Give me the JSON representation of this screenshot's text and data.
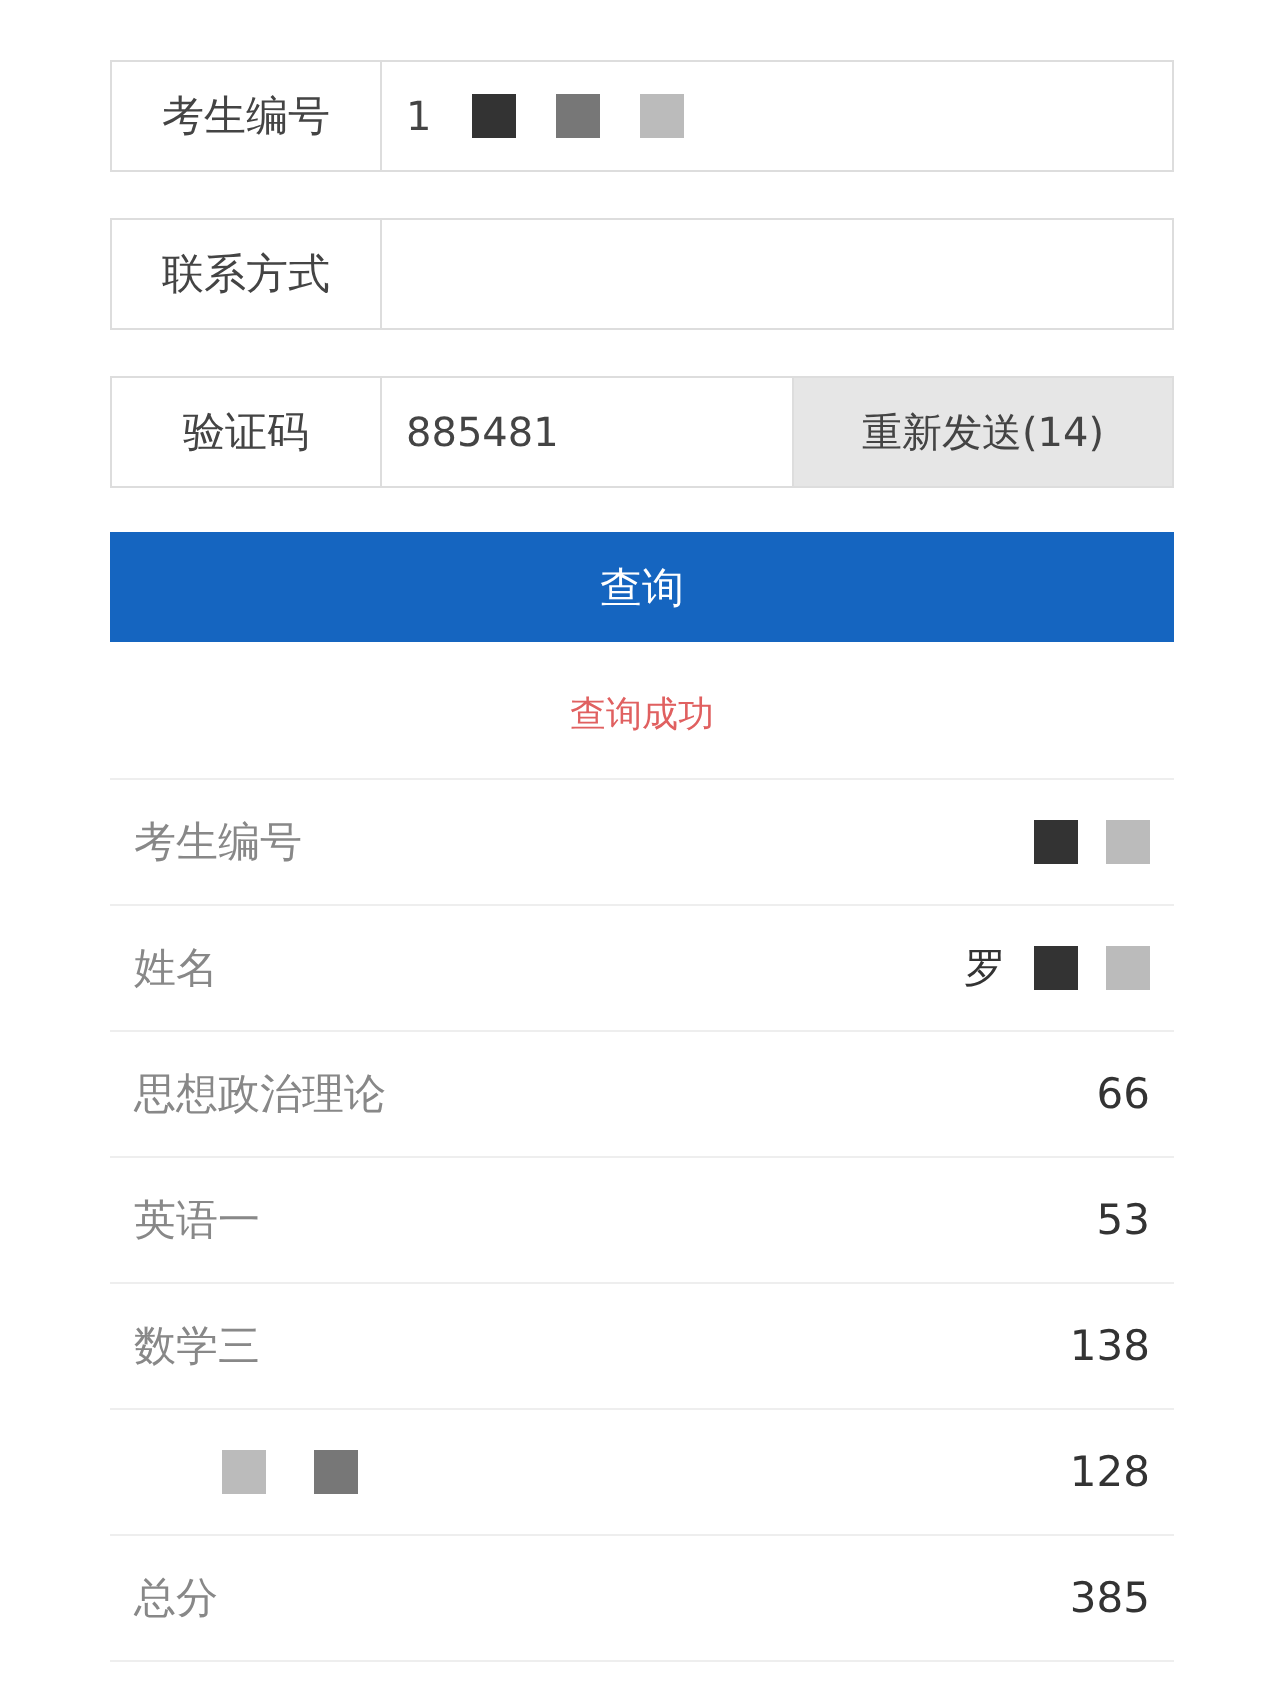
{
  "form": {
    "fields": [
      {
        "label": "考生编号",
        "value": "1",
        "redacted": true
      },
      {
        "label": "联系方式",
        "redacted": false
      },
      {
        "label": "验证码",
        "value": "885481",
        "redacted": false,
        "action": "重新发送(14)"
      }
    ],
    "submit": "查询",
    "status": "查询成功"
  },
  "results": [
    {
      "label": "考生编号",
      "redacted": true
    },
    {
      "label": "姓名",
      "value": "罗",
      "redacted": true
    },
    {
      "label": "思想政治理论",
      "value": "66",
      "redacted": false
    },
    {
      "label": "英语一",
      "value": "53",
      "redacted": false
    },
    {
      "label": "数学三",
      "value": "138",
      "redacted": false
    },
    {
      "value": "128",
      "redacted": true
    },
    {
      "label": "总分",
      "value": "385",
      "redacted": false
    }
  ]
}
